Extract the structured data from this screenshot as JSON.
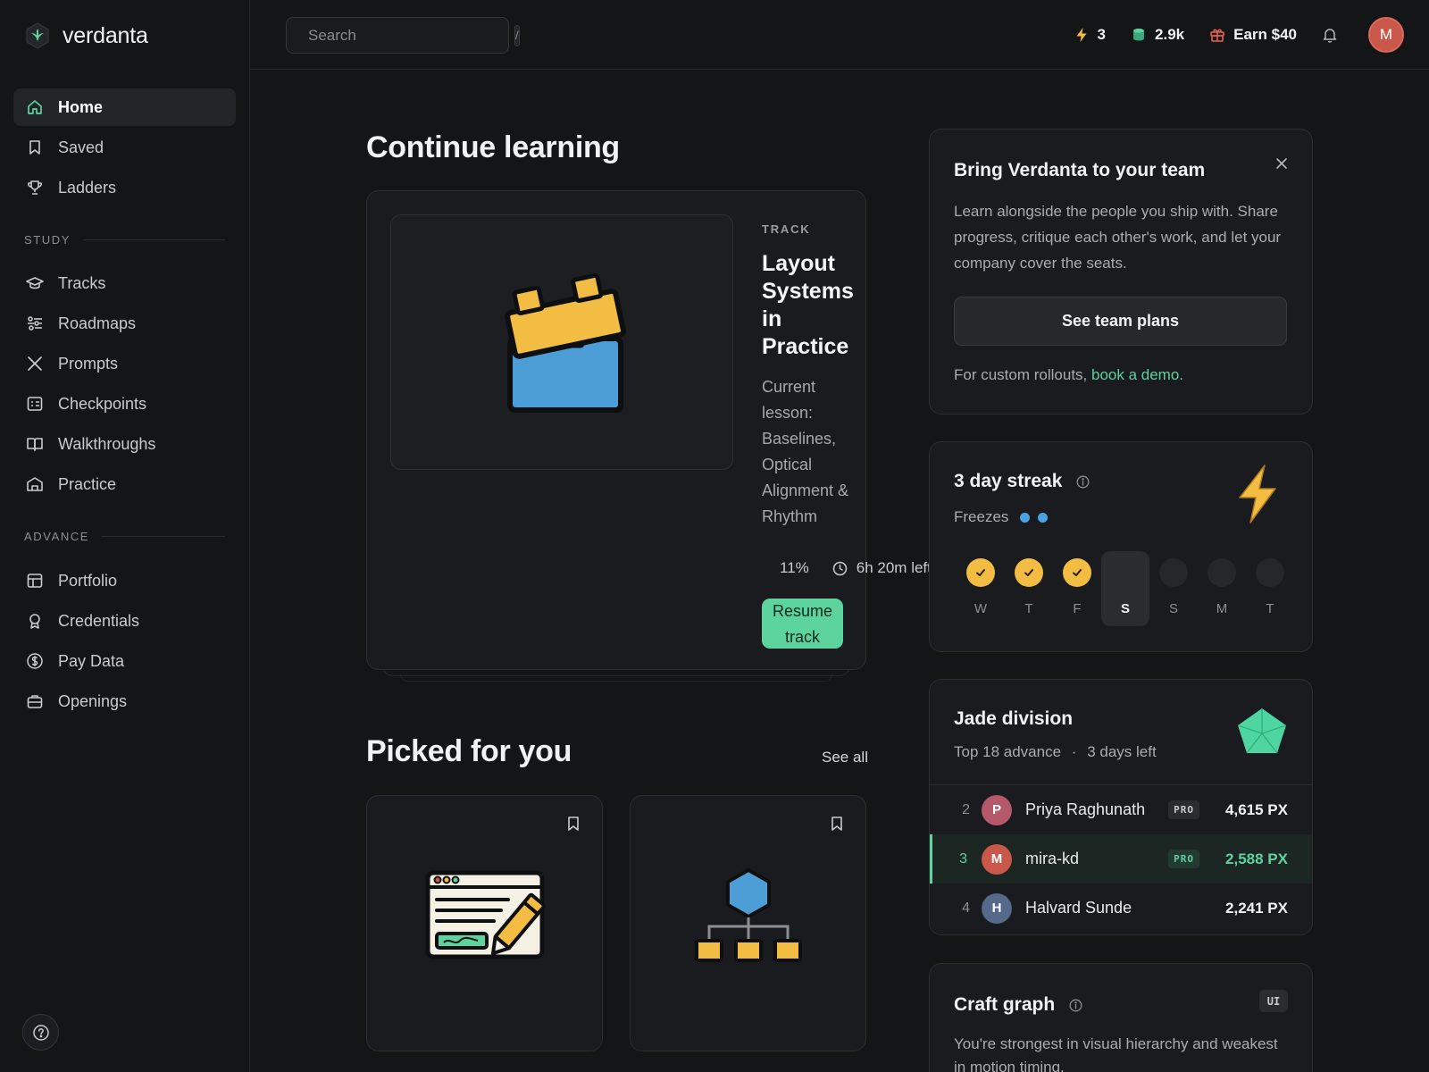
{
  "brand": {
    "name": "verdanta",
    "accent": "#5dd39e"
  },
  "sidebar": {
    "main_items": [
      {
        "label": "Home",
        "icon": "home-icon",
        "active": true
      },
      {
        "label": "Saved",
        "icon": "bookmark-icon"
      },
      {
        "label": "Ladders",
        "icon": "trophy-icon"
      }
    ],
    "study_section": "STUDY",
    "study_items": [
      {
        "label": "Tracks",
        "icon": "graduation-cap-icon"
      },
      {
        "label": "Roadmaps",
        "icon": "sliders-icon"
      },
      {
        "label": "Prompts",
        "icon": "crossed-tools-icon"
      },
      {
        "label": "Checkpoints",
        "icon": "checklist-icon"
      },
      {
        "label": "Walkthroughs",
        "icon": "open-book-icon"
      },
      {
        "label": "Practice",
        "icon": "building-icon"
      }
    ],
    "advance_section": "ADVANCE",
    "advance_items": [
      {
        "label": "Portfolio",
        "icon": "layout-icon"
      },
      {
        "label": "Credentials",
        "icon": "award-icon"
      },
      {
        "label": "Pay Data",
        "icon": "dollar-icon"
      },
      {
        "label": "Openings",
        "icon": "briefcase-icon"
      }
    ]
  },
  "topbar": {
    "search_placeholder": "Search",
    "search_shortcut": "/",
    "streak_count": "3",
    "gems_count": "2.9k",
    "earn_label": "Earn $40",
    "avatar_initial": "M"
  },
  "continue": {
    "heading": "Continue learning",
    "kicker": "TRACK",
    "title": "Layout Systems in Practice",
    "lesson": "Current lesson: Baselines, Optical Alignment & Rhythm",
    "progress_label": "11%",
    "progress": 0.11,
    "time_left": "6h 20m left",
    "resume_label": "Resume track"
  },
  "picked": {
    "heading": "Picked for you",
    "see_all": "See all"
  },
  "team": {
    "title": "Bring Verdanta to your team",
    "body": "Learn alongside the people you ship with. Share progress, critique each other's work, and let your company cover the seats.",
    "button": "See team plans",
    "foot_prefix": "For custom rollouts, ",
    "foot_link": "book a demo",
    "foot_suffix": "."
  },
  "streak": {
    "title": "3 day streak",
    "freezes_label": "Freezes",
    "freezes": 2,
    "days": [
      {
        "label": "W",
        "done": true
      },
      {
        "label": "T",
        "done": true
      },
      {
        "label": "F",
        "done": true
      },
      {
        "label": "S",
        "today": true
      },
      {
        "label": "S"
      },
      {
        "label": "M"
      },
      {
        "label": "T"
      }
    ]
  },
  "league": {
    "title": "Jade division",
    "advance": "Top 18 advance",
    "sep": "·",
    "days_left": "3 days left",
    "rows": [
      {
        "rank": "2",
        "initial": "P",
        "name": "Priya Raghunath",
        "badge": "PRO",
        "px": "4,615 PX",
        "color": "#b4586a"
      },
      {
        "rank": "3",
        "initial": "M",
        "name": "mira-kd",
        "badge": "PRO",
        "px": "2,588 PX",
        "color": "#c9574a",
        "me": true
      },
      {
        "rank": "4",
        "initial": "H",
        "name": "Halvard Sunde",
        "badge": "",
        "px": "2,241 PX",
        "color": "#55698a"
      }
    ]
  },
  "craft": {
    "title": "Craft graph",
    "badge": "UI",
    "body": "You're strongest in visual hierarchy and weakest in motion timing."
  }
}
